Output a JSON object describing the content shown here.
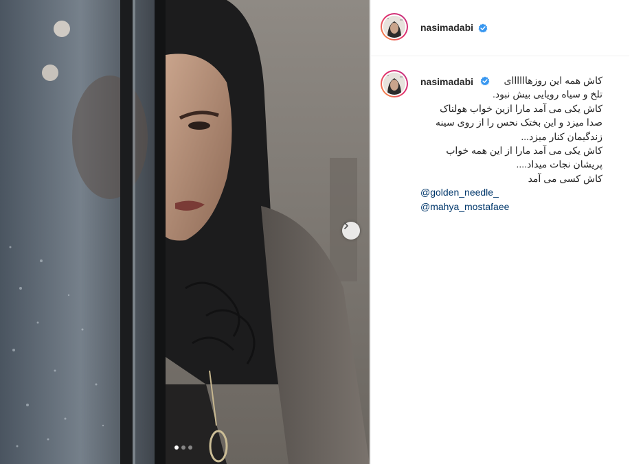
{
  "post": {
    "username": "nasimadabi",
    "verified_icon": "verified-badge-icon",
    "caption_lines": [
      "کاش همه این روزهاااااای",
      "تلخ و سیاه رویایی بیش نبود.",
      "کاش یکی می آمد مارا ازین خواب هولناک",
      "صدا میزد و این بختک نحس را از روی سینه",
      "زندگیمان کنار میزد...",
      "کاش یکی می آمد مارا از این همه خواب",
      "پریشان نجات میداد....",
      "کاش کسی می آمد"
    ],
    "mentions": [
      "@golden_needle_",
      "@mahya_mostafaee"
    ]
  },
  "carousel": {
    "slide_count": 3,
    "active_index": 0,
    "next_icon": "chevron-right-icon"
  },
  "colors": {
    "username": "#262626",
    "mention": "#00376b",
    "verified": "#3897f0",
    "border": "#efefef"
  }
}
